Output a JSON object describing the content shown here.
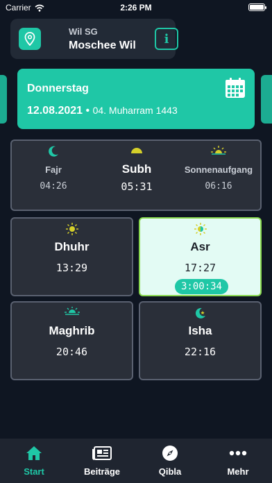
{
  "status_bar": {
    "carrier": "Carrier",
    "time": "2:26 PM"
  },
  "mosque": {
    "city": "Wil SG",
    "name": "Moschee Wil",
    "info_icon": "i"
  },
  "date": {
    "weekday": "Donnerstag",
    "gregorian": "12.08.2021",
    "separator": " • ",
    "hijri": "04. Muharram 1443"
  },
  "morning": [
    {
      "label": "Fajr",
      "time": "04:26",
      "icon": "crescent-icon"
    },
    {
      "label": "Subh",
      "time": "05:31",
      "icon": "half-sun-icon"
    },
    {
      "label": "Sonnenaufgang",
      "time": "06:16",
      "icon": "sunrise-icon"
    }
  ],
  "prayers": {
    "dhuhr": {
      "label": "Dhuhr",
      "time": "13:29",
      "icon": "sun-icon"
    },
    "asr": {
      "label": "Asr",
      "time": "17:27",
      "countdown": "3:00:34",
      "icon": "sun-icon"
    },
    "maghrib": {
      "label": "Maghrib",
      "time": "20:46",
      "icon": "sunset-icon"
    },
    "isha": {
      "label": "Isha",
      "time": "22:16",
      "icon": "crescent-star-icon"
    }
  },
  "tabs": [
    {
      "label": "Start",
      "icon": "home-icon"
    },
    {
      "label": "Beiträge",
      "icon": "newspaper-icon"
    },
    {
      "label": "Qibla",
      "icon": "compass-icon"
    },
    {
      "label": "Mehr",
      "icon": "more-icon"
    }
  ],
  "colors": {
    "accent": "#1fc7a6",
    "background": "#0f1622",
    "card": "#2a2f39",
    "highlight": "#e3fbf4",
    "sun": "#d4cf2a"
  }
}
